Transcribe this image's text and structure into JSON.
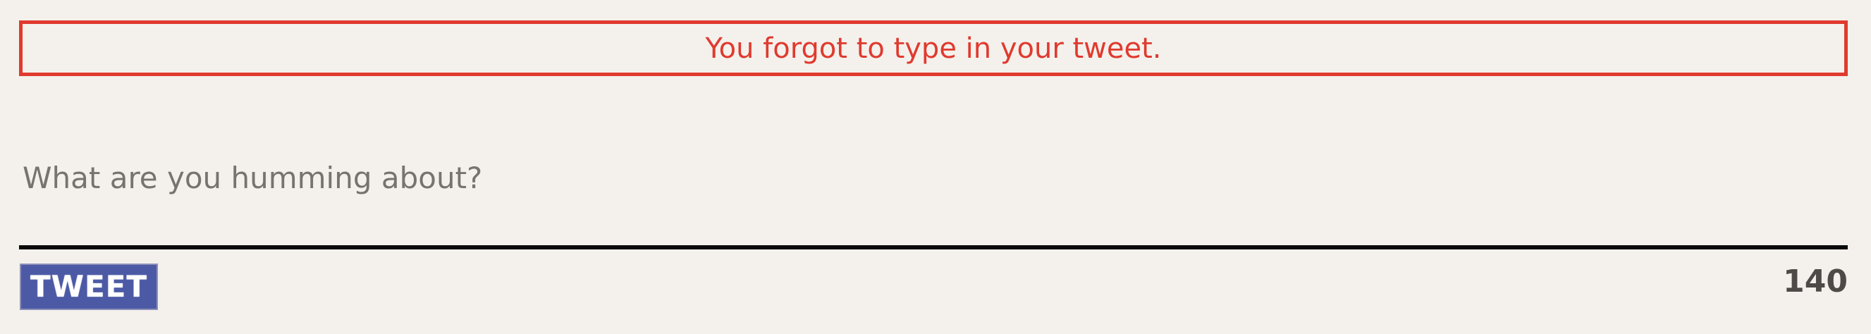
{
  "error": {
    "message": "You forgot to type in your tweet."
  },
  "composer": {
    "placeholder": "What are you humming about?",
    "value": ""
  },
  "actions": {
    "tweet_label": "TWEET"
  },
  "counter": {
    "remaining": "140"
  },
  "colors": {
    "error": "#e03a2f",
    "background": "#f4f1ec",
    "button": "#4c5aa6",
    "divider": "#0a0a0a",
    "counter": "#4e4a47"
  }
}
